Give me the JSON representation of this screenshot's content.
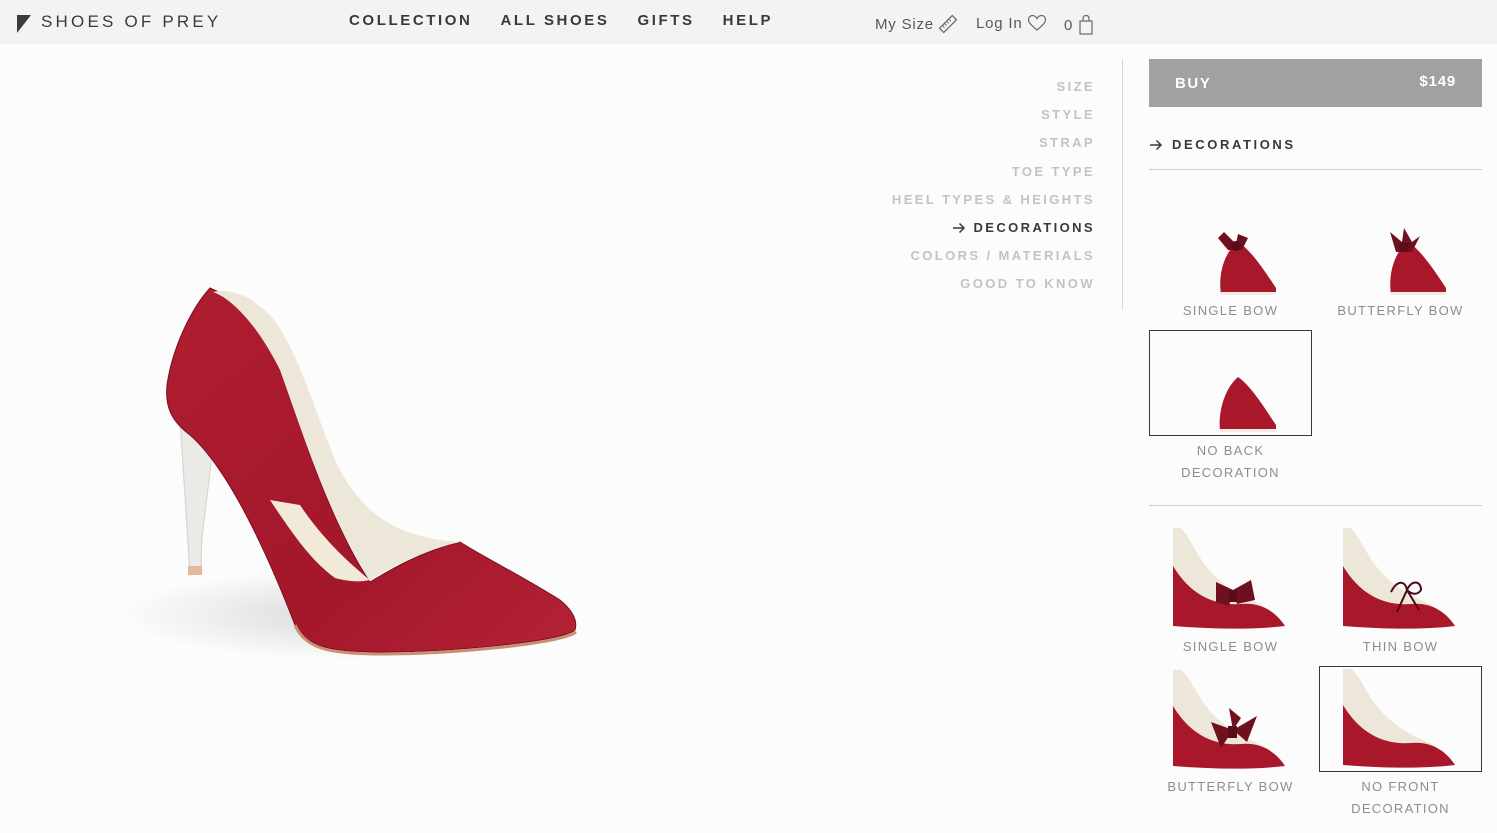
{
  "header": {
    "logo_text": "SHOES OF PREY",
    "nav": [
      "COLLECTION",
      "ALL SHOES",
      "GIFTS",
      "HELP"
    ],
    "my_size": "My Size",
    "login": "Log In",
    "cart_count": "0",
    "icons": [
      "logo-mark-icon",
      "ruler-icon",
      "heart-icon",
      "shopping-bag-icon"
    ]
  },
  "steps": {
    "items": [
      "SIZE",
      "STYLE",
      "STRAP",
      "TOE TYPE",
      "HEEL TYPES & HEIGHTS",
      "DECORATIONS",
      "COLORS / MATERIALS",
      "GOOD TO KNOW"
    ],
    "active": "DECORATIONS"
  },
  "buy": {
    "label": "BUY",
    "price": "$149"
  },
  "panel": {
    "section_title": "DECORATIONS",
    "back_options": [
      {
        "label": "SINGLE BOW",
        "selected": false
      },
      {
        "label": "BUTTERFLY BOW",
        "selected": false
      },
      {
        "label": "NO BACK DECORATION",
        "selected": true
      }
    ],
    "front_options": [
      {
        "label": "SINGLE BOW",
        "selected": false
      },
      {
        "label": "THIN BOW",
        "selected": false
      },
      {
        "label": "BUTTERFLY BOW",
        "selected": false
      },
      {
        "label": "NO FRONT DECORATION",
        "selected": true
      }
    ]
  },
  "colors": {
    "shoe": "#a8172a",
    "lining": "#ece7d9",
    "bow": "#6e1020",
    "buy_bg": "#a3a0a1"
  }
}
